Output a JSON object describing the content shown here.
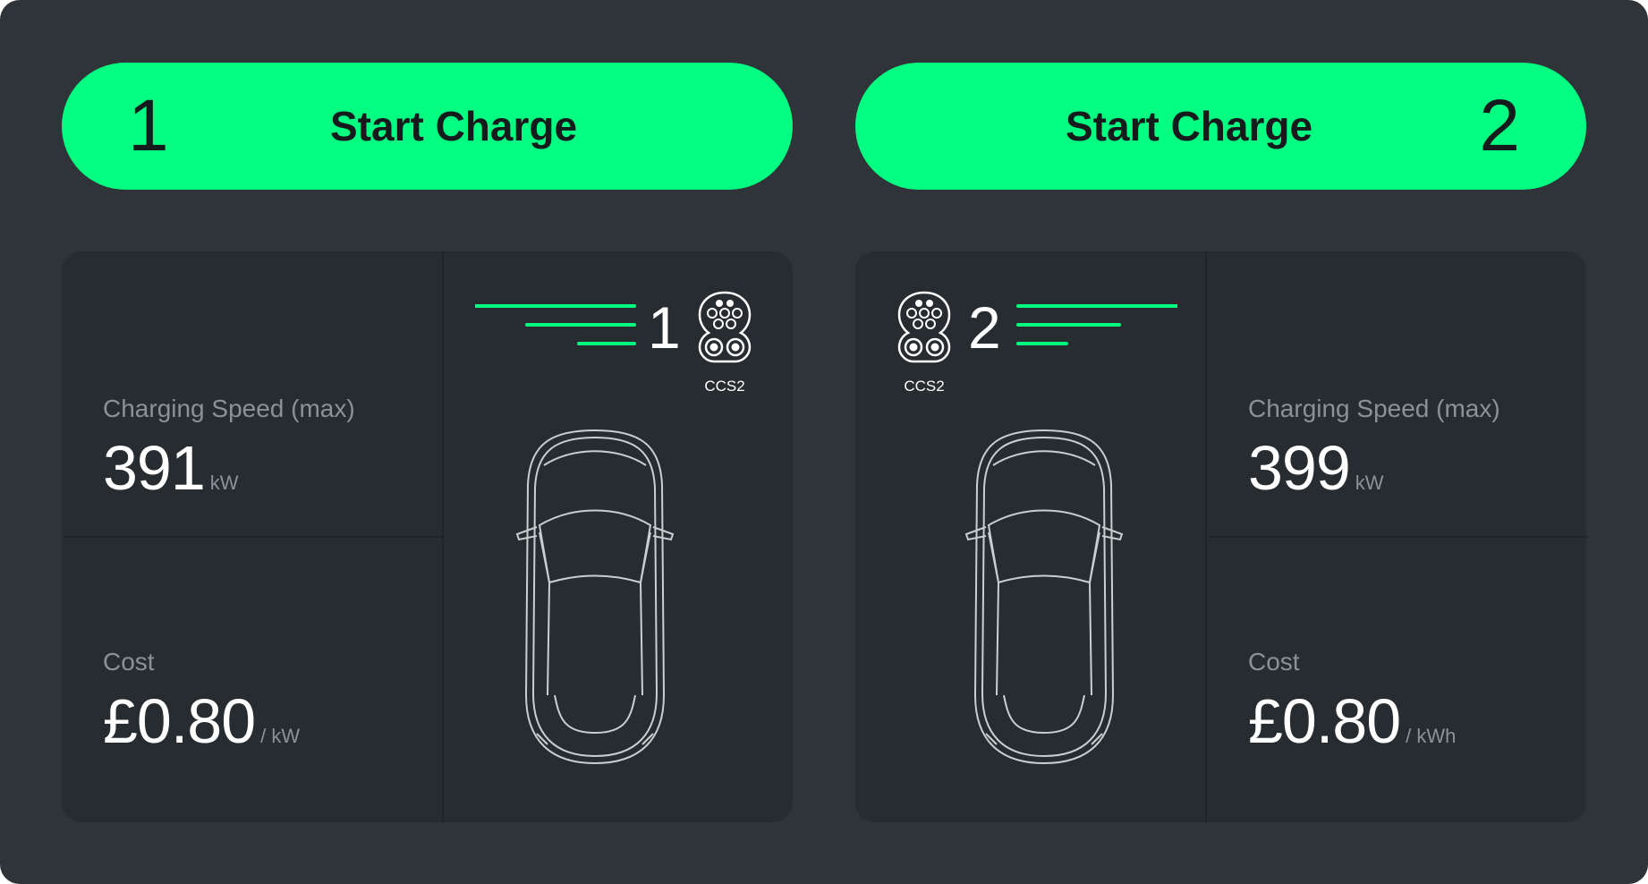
{
  "colors": {
    "accent": "#03fe82",
    "background": "#2e3438",
    "panel": "#272c30",
    "text": "#ffffff",
    "muted": "#8b9296"
  },
  "chargers": [
    {
      "number": "1",
      "button_label": "Start Charge",
      "connector": "CCS2",
      "connector_icon": "ccs2-connector-icon",
      "speed_label": "Charging Speed (max)",
      "speed_value": "391",
      "speed_unit": "kW",
      "cost_label": "Cost",
      "cost_value": "£0.80",
      "cost_unit": "/ kW"
    },
    {
      "number": "2",
      "button_label": "Start Charge",
      "connector": "CCS2",
      "connector_icon": "ccs2-connector-icon",
      "speed_label": "Charging Speed (max)",
      "speed_value": "399",
      "speed_unit": "kW",
      "cost_label": "Cost",
      "cost_value": "£0.80",
      "cost_unit": "/ kWh"
    }
  ]
}
